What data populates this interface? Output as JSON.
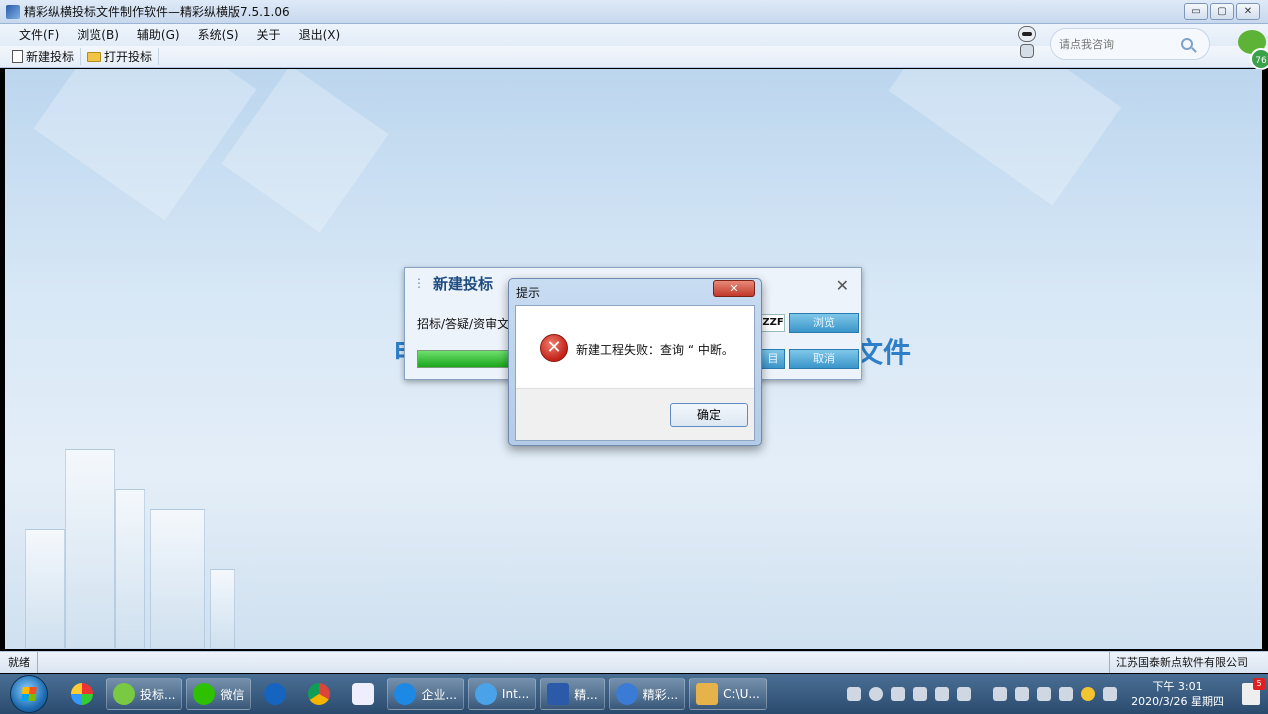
{
  "window": {
    "title": "精彩纵横投标文件制作软件—精彩纵横版7.5.1.06",
    "minimize_label": "▭",
    "maximize_label": "▢",
    "close_label": "✕"
  },
  "menu": {
    "file": "文件(F)",
    "browse": "浏览(B)",
    "assist": "辅助(G)",
    "system": "系统(S)",
    "about": "关于",
    "exit": "退出(X)"
  },
  "toolbar": {
    "new_bid": "新建投标",
    "open_bid": "打开投标"
  },
  "search": {
    "placeholder": "请点我咨询"
  },
  "badge": {
    "count": "76"
  },
  "background": {
    "left_char": "电",
    "right_text": "文件"
  },
  "new_bid_dialog": {
    "title": "新建投标",
    "field_label": "招标/答疑/资审文",
    "file_ext": "ZZF",
    "browse_button": "浏览",
    "mid_button": "目",
    "cancel_button": "取消",
    "progress": 0.95
  },
  "alert_dialog": {
    "title": "提示",
    "close_label": "✕",
    "message": "新建工程失败：查询 “ 中断。",
    "ok_button": "确定"
  },
  "status": {
    "left": "就绪",
    "right": "江苏国泰新点软件有限公司"
  },
  "taskbar": {
    "items": [
      {
        "label": "投标..."
      },
      {
        "label": "微信"
      },
      {
        "label": "企业..."
      },
      {
        "label": "Int..."
      },
      {
        "label": "精..."
      },
      {
        "label": "精彩..."
      },
      {
        "label": "C:\\U..."
      }
    ],
    "clock_time": "下午 3:01",
    "clock_date": "2020/3/26 星期四",
    "notification_count": "5"
  }
}
